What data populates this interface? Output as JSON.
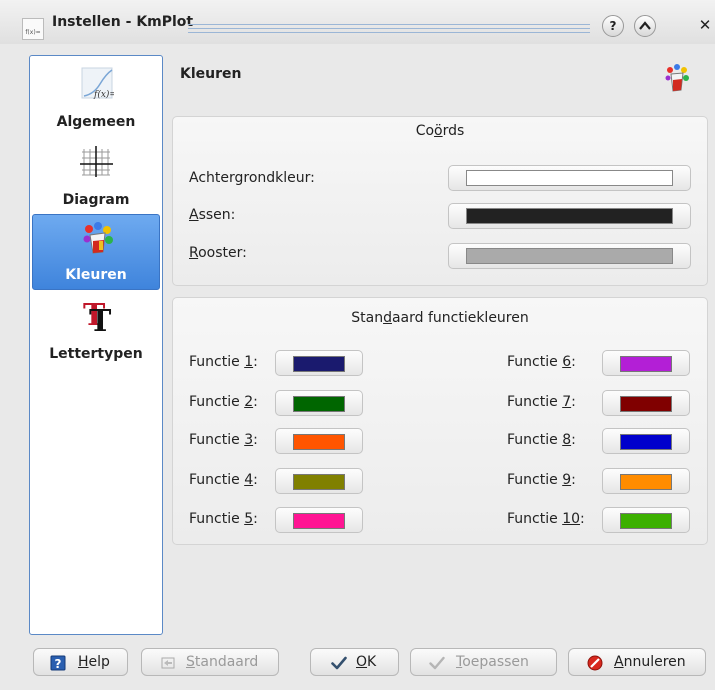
{
  "window": {
    "title": "Instellen - KmPlot",
    "app_icon_text": "f(x)=",
    "help_glyph": "?",
    "shade_glyph": "^",
    "close_glyph": "✕"
  },
  "sidebar": {
    "items": [
      {
        "label": "Algemeen",
        "icon": "function-graph-icon",
        "icon_text": "f(x)=",
        "active": false
      },
      {
        "label": "Diagram",
        "icon": "grid-icon",
        "active": false
      },
      {
        "label": "Kleuren",
        "icon": "paint-bucket-icon",
        "active": true
      },
      {
        "label": "Lettertypen",
        "icon": "font-icon",
        "icon_text": "T",
        "active": false
      }
    ]
  },
  "page": {
    "title": "Kleuren"
  },
  "coords_group": {
    "title_pre": "Co",
    "title_accel": "ö",
    "title_post": "rds",
    "rows": [
      {
        "pre": "",
        "accel": "",
        "post": "Achtergrondkleur:",
        "color": "#ffffff"
      },
      {
        "pre": "",
        "accel": "A",
        "post": "ssen:",
        "color": "#222222"
      },
      {
        "pre": "",
        "accel": "R",
        "post": "ooster:",
        "color": "#aaaaaa"
      }
    ]
  },
  "functions_group": {
    "title_pre": "Stan",
    "title_accel": "d",
    "title_post": "aard functiekleuren",
    "left": [
      {
        "pre": "Functie ",
        "accel": "1",
        "post": ":",
        "color": "#1a1a6e"
      },
      {
        "pre": "Functie ",
        "accel": "2",
        "post": ":",
        "color": "#006600"
      },
      {
        "pre": "Functie ",
        "accel": "3",
        "post": ":",
        "color": "#ff5500"
      },
      {
        "pre": "Functie ",
        "accel": "4",
        "post": ":",
        "color": "#808000"
      },
      {
        "pre": "Functie ",
        "accel": "5",
        "post": ":",
        "color": "#ff1493"
      }
    ],
    "right": [
      {
        "pre": "Functie ",
        "accel": "6",
        "post": ":",
        "color": "#b31fd6"
      },
      {
        "pre": "Functie ",
        "accel": "7",
        "post": ":",
        "color": "#800000"
      },
      {
        "pre": "Functie ",
        "accel": "8",
        "post": ":",
        "color": "#0000cc"
      },
      {
        "pre": "Functie ",
        "accel": "9",
        "post": ":",
        "color": "#ff8c00"
      },
      {
        "pre": "Functie ",
        "accel": "10",
        "post": ":",
        "color": "#3cb000"
      }
    ]
  },
  "buttons": {
    "help": {
      "pre": "",
      "accel": "H",
      "post": "elp",
      "icon": "help-book-icon"
    },
    "standaard": {
      "pre": "",
      "accel": "S",
      "post": "tandaard",
      "icon": "restore-icon",
      "disabled": true
    },
    "ok": {
      "pre": "",
      "accel": "O",
      "post": "K",
      "icon": "checkmark-icon"
    },
    "toepassen": {
      "pre": "",
      "accel": "T",
      "post": "oepassen",
      "icon": "apply-checkmark-icon",
      "disabled": true
    },
    "annuleren": {
      "pre": "",
      "accel": "A",
      "post": "nnuleren",
      "icon": "cancel-icon"
    }
  },
  "colors": {
    "accent": "#4a8ee6",
    "sidebar_border": "#5b89c6"
  }
}
